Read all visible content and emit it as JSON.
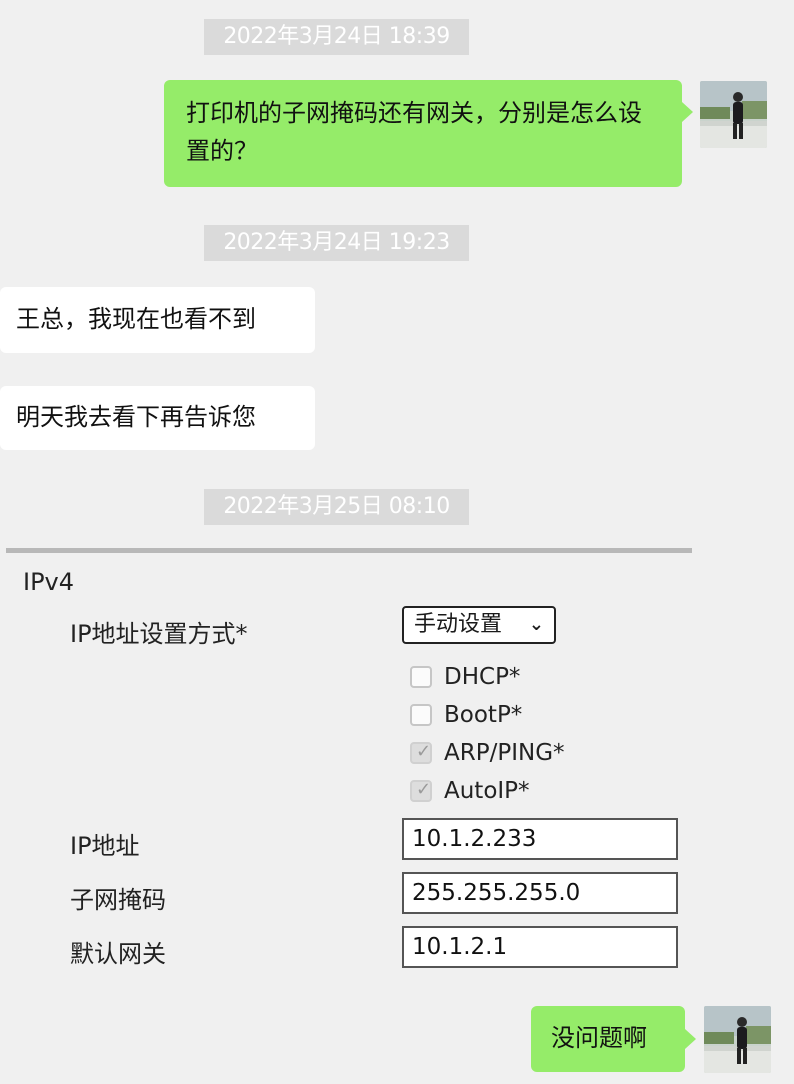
{
  "messages": {
    "ts1": "2022年3月24日 18:39",
    "msg1": "打印机的子网掩码还有网关，分别是怎么设置的？",
    "ts2": "2022年3月24日 19:23",
    "msg2": "王总，我现在也看不到",
    "msg3": "明天我去看下再告诉您",
    "ts3": "2022年3月25日 08:10",
    "msg4": "没问题啊"
  },
  "ipv4": {
    "title": "IPv4",
    "method_label": "IP地址设置方式*",
    "method_value": "手动设置",
    "options": [
      {
        "label": "DHCP*",
        "checked": false
      },
      {
        "label": "BootP*",
        "checked": false
      },
      {
        "label": "ARP/PING*",
        "checked": true
      },
      {
        "label": "AutoIP*",
        "checked": true
      }
    ],
    "ip_label": "IP地址",
    "ip_value": "10.1.2.233",
    "mask_label": "子网掩码",
    "mask_value": "255.255.255.0",
    "gateway_label": "默认网关",
    "gateway_value": "10.1.2.1"
  },
  "colors": {
    "outgoing_bubble": "#95ec69",
    "incoming_bubble": "#ffffff",
    "timestamp_bg": "#dadada",
    "background": "#f0f0f0"
  },
  "icons": {
    "chevron": "chevron-down-icon",
    "check": "checkmark-icon"
  }
}
